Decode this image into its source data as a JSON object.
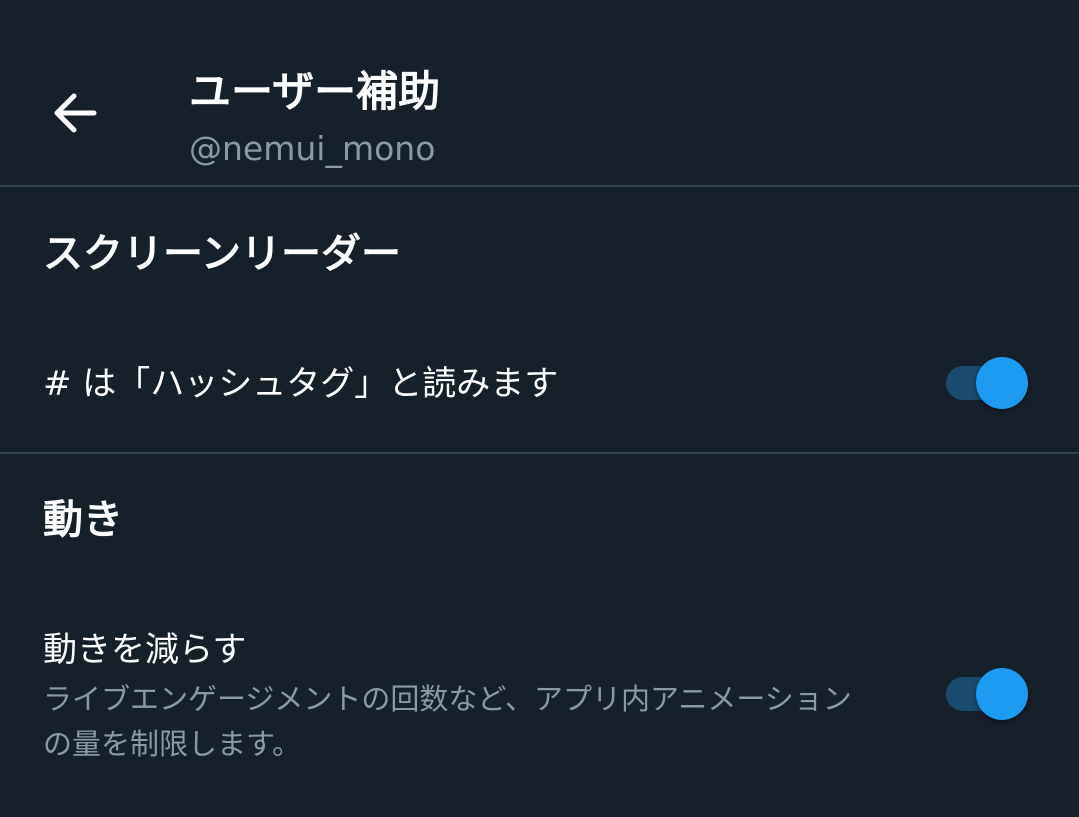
{
  "header": {
    "title": "ユーザー補助",
    "handle": "@nemui_mono",
    "back_icon": "arrow-left-icon"
  },
  "sections": [
    {
      "title": "スクリーンリーダー",
      "rows": [
        {
          "label": "# は「ハッシュタグ」と読みます",
          "toggle_on": true
        }
      ]
    },
    {
      "title": "動き",
      "rows": [
        {
          "label": "動きを減らす",
          "description": "ライブエンゲージメントの回数など、アプリ内アニメーションの量を制限します。",
          "toggle_on": true
        }
      ]
    }
  ],
  "colors": {
    "background": "#15202b",
    "text_primary": "#ffffff",
    "text_secondary": "#8b98a5",
    "divider": "#38444d",
    "toggle_knob": "#1d9bf0",
    "toggle_track": "#1a4a6c"
  }
}
